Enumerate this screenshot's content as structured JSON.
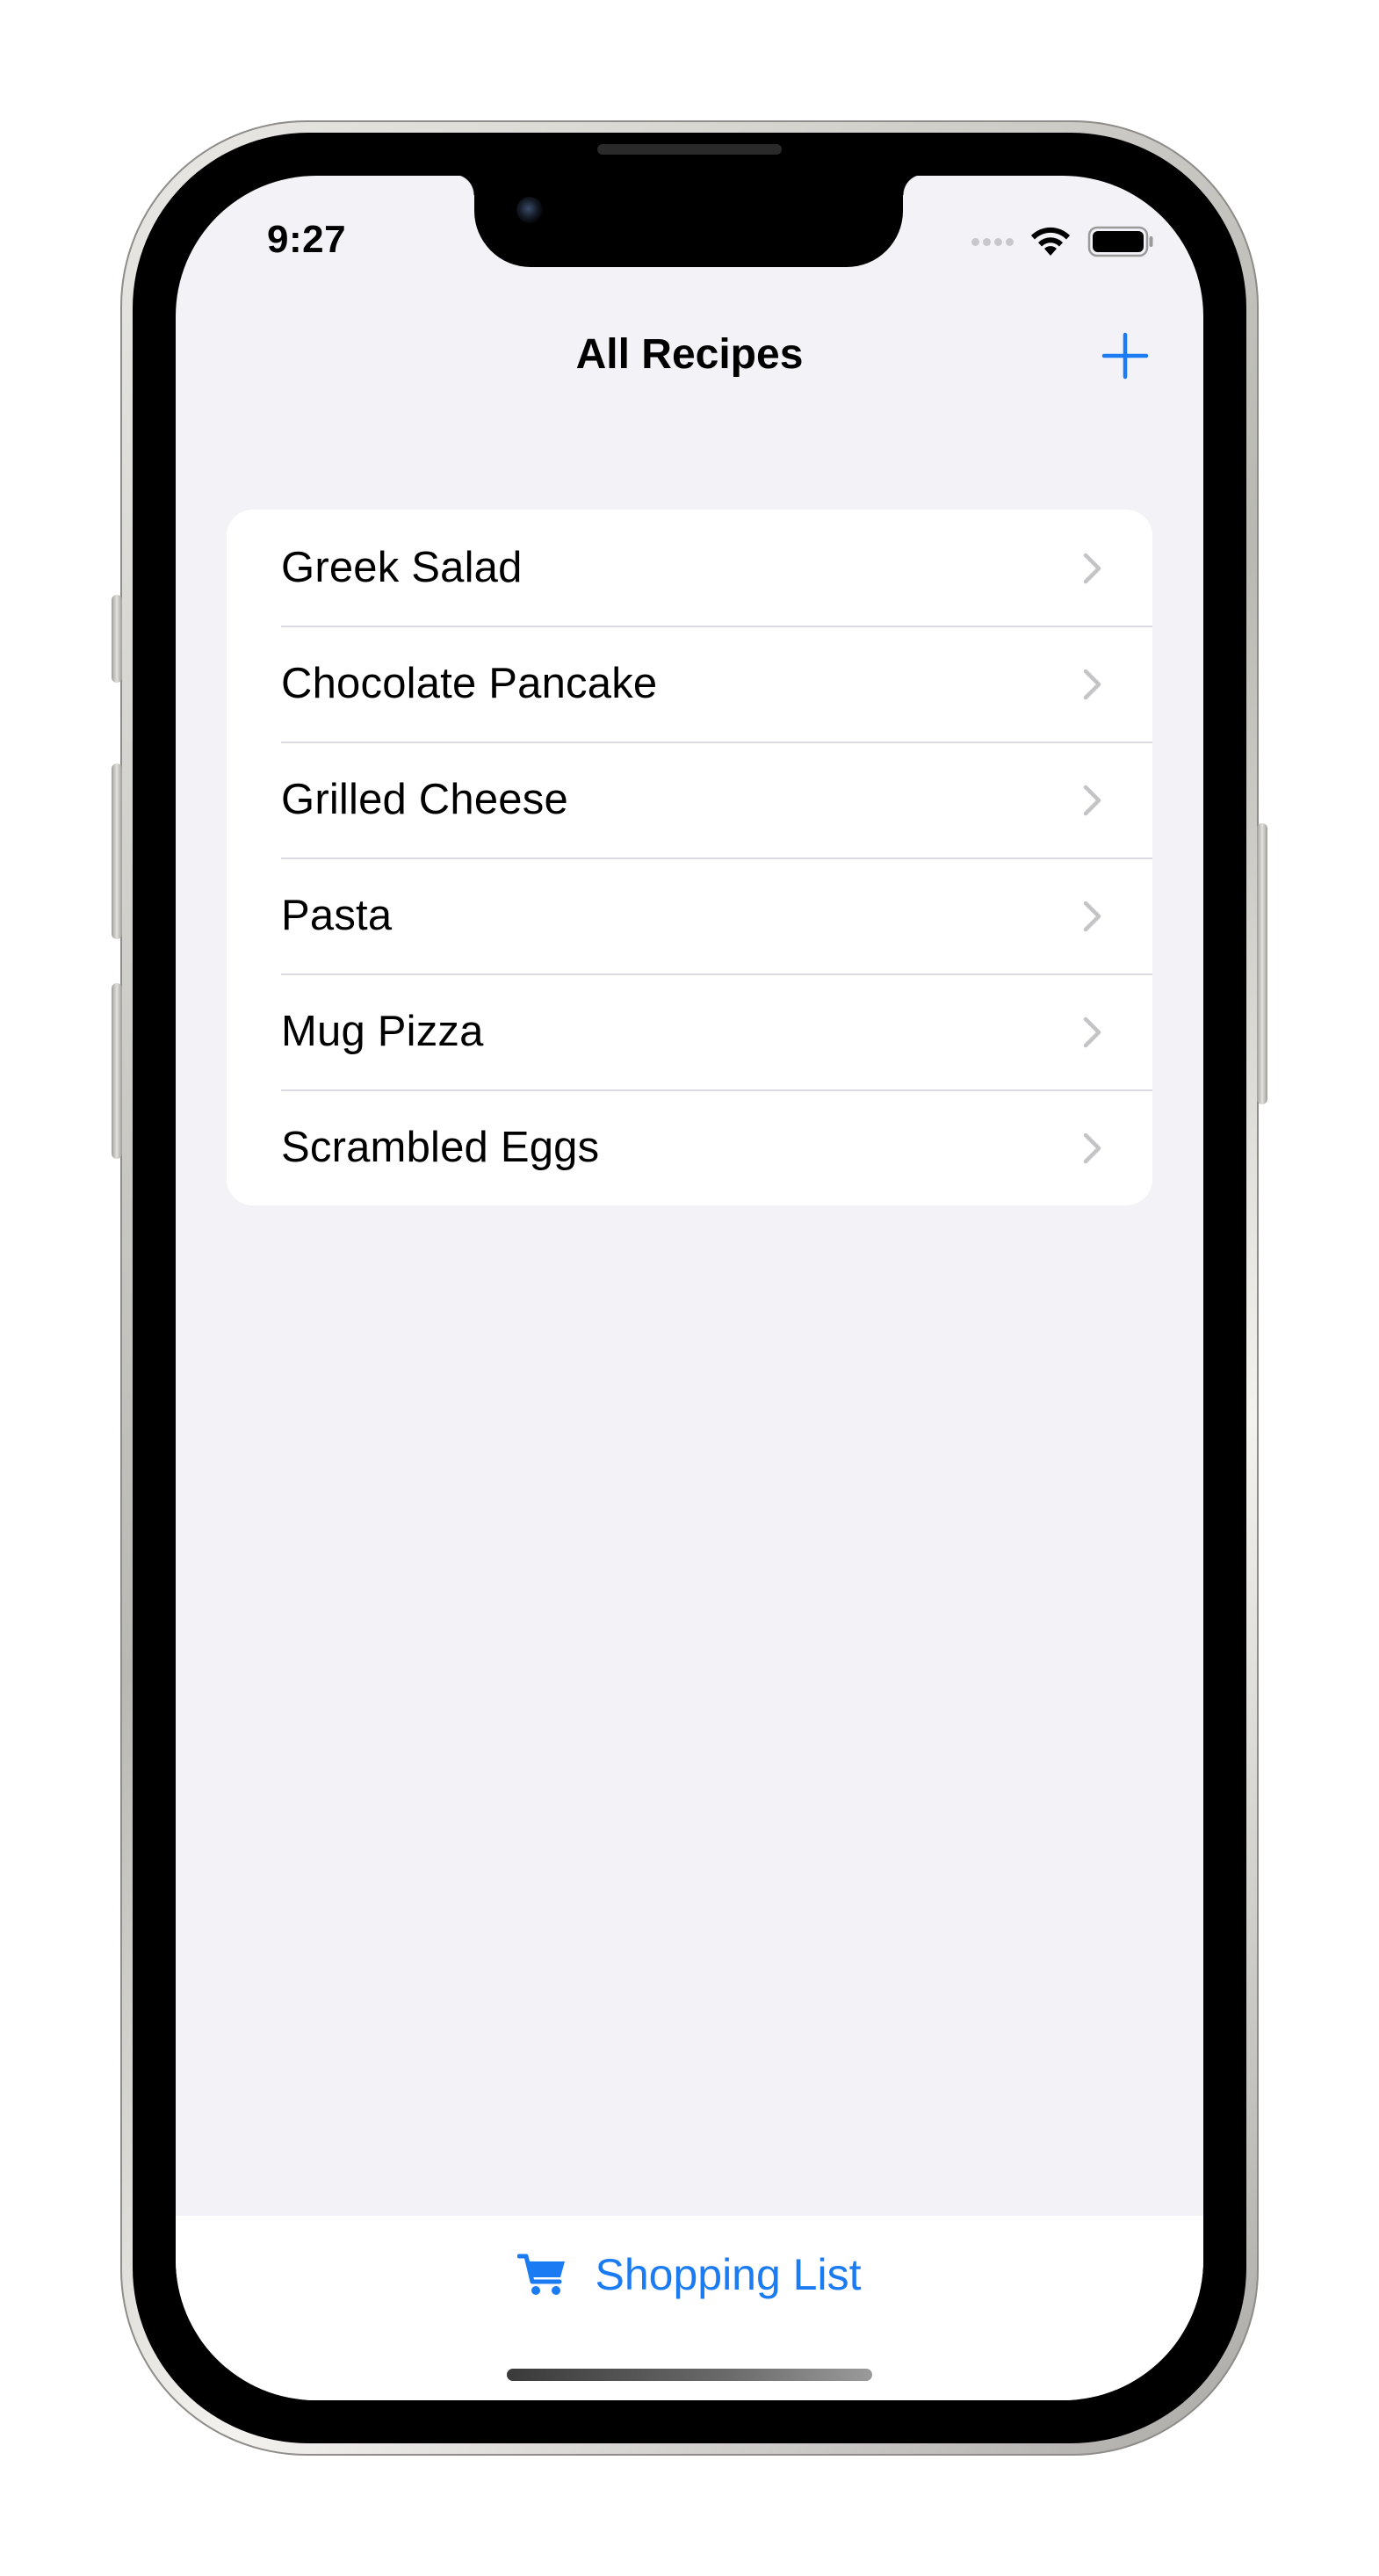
{
  "status_bar": {
    "time": "9:27"
  },
  "navigation": {
    "title": "All Recipes",
    "add_icon": "plus-icon"
  },
  "recipes": {
    "items": [
      {
        "label": "Greek Salad"
      },
      {
        "label": "Chocolate Pancake"
      },
      {
        "label": "Grilled Cheese"
      },
      {
        "label": "Pasta"
      },
      {
        "label": "Mug Pizza"
      },
      {
        "label": "Scrambled Eggs"
      }
    ]
  },
  "toolbar": {
    "shopping_label": "Shopping List",
    "shopping_icon": "cart-icon"
  },
  "colors": {
    "accent": "#1a7bf2",
    "background": "#f2f2f7",
    "cell": "#ffffff",
    "chevron": "#c4c4c7"
  }
}
